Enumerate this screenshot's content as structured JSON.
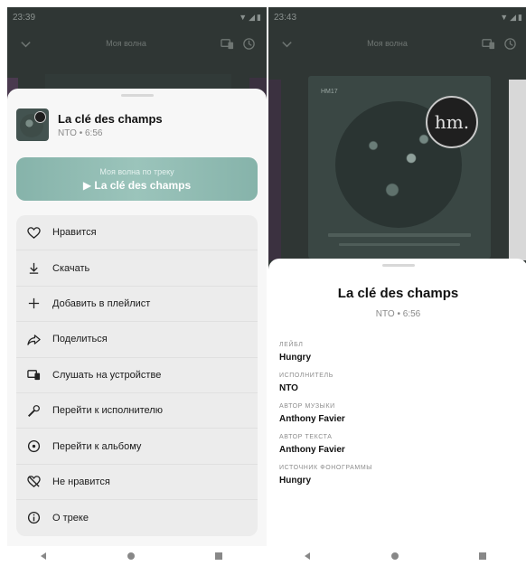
{
  "left": {
    "status": {
      "time": "23:39"
    },
    "top_bar": {
      "title": "Моя волна"
    },
    "track": {
      "title": "La clé des champs",
      "subtitle": "NTO • 6:56"
    },
    "wave_button": {
      "caption": "Моя волна по треку",
      "label": "▶ La clé des champs"
    },
    "menu": [
      {
        "label": "Нравится",
        "icon": "heart-icon"
      },
      {
        "label": "Скачать",
        "icon": "download-icon"
      },
      {
        "label": "Добавить в плейлист",
        "icon": "plus-icon"
      },
      {
        "label": "Поделиться",
        "icon": "share-icon"
      },
      {
        "label": "Слушать на устройстве",
        "icon": "devices-icon"
      },
      {
        "label": "Перейти к исполнителю",
        "icon": "microphone-icon"
      },
      {
        "label": "Перейти к альбому",
        "icon": "album-icon"
      },
      {
        "label": "Не нравится",
        "icon": "dislike-icon"
      },
      {
        "label": "О треке",
        "icon": "info-icon"
      }
    ]
  },
  "right": {
    "status": {
      "time": "23:43"
    },
    "top_bar": {
      "title": "Моя волна"
    },
    "album": {
      "code": "HM17",
      "logo": "hm."
    },
    "info": {
      "title": "La clé des champs",
      "subtitle": "NTO • 6:56",
      "details": [
        {
          "label": "ЛЕЙБЛ",
          "value": "Hungry"
        },
        {
          "label": "ИСПОЛНИТЕЛЬ",
          "value": "NTO"
        },
        {
          "label": "АВТОР МУЗЫКИ",
          "value": "Anthony Favier"
        },
        {
          "label": "АВТОР ТЕКСТА",
          "value": "Anthony Favier"
        },
        {
          "label": "ИСТОЧНИК ФОНОГРАММЫ",
          "value": "Hungry"
        }
      ]
    }
  },
  "colors": {
    "accent": "#8fbcb3",
    "sheet": "#f7f7f7",
    "backdrop": "#2f3634"
  }
}
